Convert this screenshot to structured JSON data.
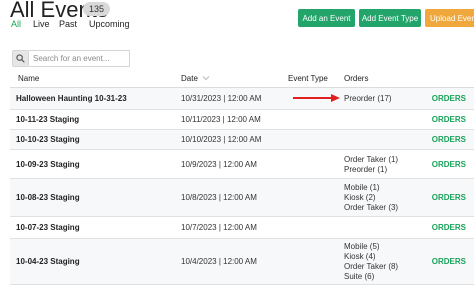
{
  "header": {
    "title": "All Events",
    "count": "135"
  },
  "tabs": [
    {
      "label": "All",
      "active": true
    },
    {
      "label": "Live",
      "active": false
    },
    {
      "label": "Past",
      "active": false
    },
    {
      "label": "Upcoming",
      "active": false
    }
  ],
  "buttons": {
    "add_event": "Add an Event",
    "add_event_type": "Add Event Type",
    "upload_event": "Upload Even"
  },
  "search": {
    "placeholder": "Search for an event..."
  },
  "columns": {
    "name": "Name",
    "date": "Date",
    "event_type": "Event Type",
    "orders": "Orders"
  },
  "colors": {
    "accent": "#1aa35a",
    "button_green": "#22a46a",
    "button_orange": "#f0a83d",
    "arrow": "#e02020"
  },
  "rows": [
    {
      "name": "Halloween Haunting 10-31-23",
      "date": "10/31/2023 | 12:00 AM",
      "event_type": "",
      "orders": [
        "Preorder (17)"
      ],
      "action": "ORDERS"
    },
    {
      "name": "10-11-23 Staging",
      "date": "10/11/2023 | 12:00 AM",
      "event_type": "",
      "orders": [],
      "action": "ORDERS"
    },
    {
      "name": "10-10-23 Staging",
      "date": "10/10/2023 | 12:00 AM",
      "event_type": "",
      "orders": [],
      "action": "ORDERS"
    },
    {
      "name": "10-09-23 Staging",
      "date": "10/9/2023 | 12:00 AM",
      "event_type": "",
      "orders": [
        "Order Taker (1)",
        "Preorder (1)"
      ],
      "action": "ORDERS"
    },
    {
      "name": "10-08-23 Staging",
      "date": "10/8/2023 | 12:00 AM",
      "event_type": "",
      "orders": [
        "Mobile (1)",
        "Kiosk (2)",
        "Order Taker (3)"
      ],
      "action": "ORDERS"
    },
    {
      "name": "10-07-23 Staging",
      "date": "10/7/2023 | 12:00 AM",
      "event_type": "",
      "orders": [],
      "action": "ORDERS"
    },
    {
      "name": "10-04-23 Staging",
      "date": "10/4/2023 | 12:00 AM",
      "event_type": "",
      "orders": [
        "Mobile (5)",
        "Kiosk (4)",
        "Order Taker (8)",
        "Suite (6)"
      ],
      "action": "ORDERS"
    }
  ]
}
